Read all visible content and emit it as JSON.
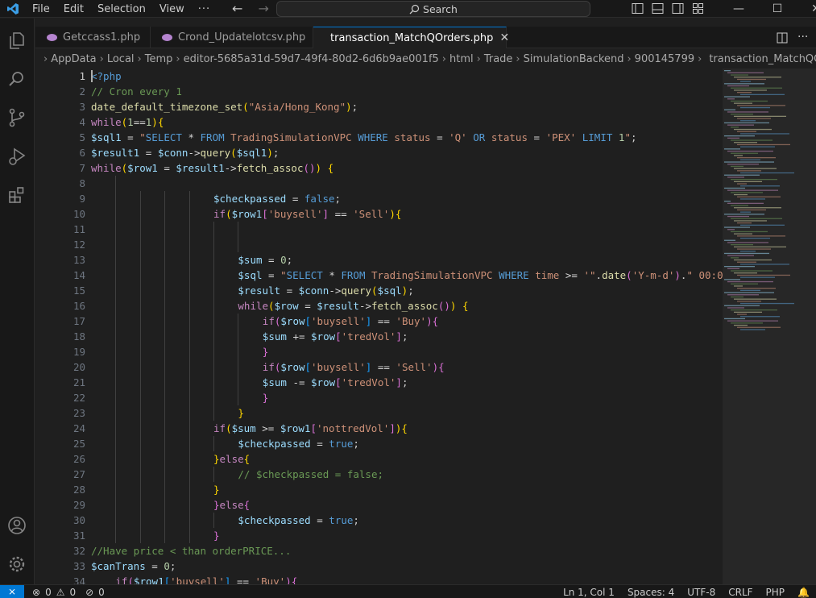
{
  "menu": {
    "file": "File",
    "edit": "Edit",
    "selection": "Selection",
    "view": "View",
    "more": "···"
  },
  "search": {
    "label": "Search"
  },
  "window": {
    "minimize": "—",
    "maximize": "☐",
    "close": "✕"
  },
  "tabs": [
    {
      "label": "Getccass1.php"
    },
    {
      "label": "Crond_Updatelotcsv.php"
    },
    {
      "label": "transaction_MatchQOrders.php",
      "close": "✕"
    }
  ],
  "breadcrumb": [
    "AppData",
    "Local",
    "Temp",
    "editor-5685a31d-59d7-49f4-80d2-6d6b9ae001f5",
    "html",
    "Trade",
    "SimulationBackend",
    "900145799",
    "transaction_MatchQOrders.php"
  ],
  "line_numbers": [
    "1",
    "2",
    "3",
    "4",
    "5",
    "6",
    "7",
    "8",
    "9",
    "10",
    "11",
    "12",
    "13",
    "14",
    "15",
    "16",
    "17",
    "18",
    "19",
    "20",
    "21",
    "22",
    "23",
    "24",
    "25",
    "26",
    "27",
    "28",
    "29",
    "30",
    "31",
    "32",
    "33",
    "34"
  ],
  "status": {
    "remote": "⨯",
    "errors": "0",
    "warnings": "0",
    "ports": "0",
    "position": "Ln 1, Col 1",
    "spaces": "Spaces: 4",
    "encoding": "UTF-8",
    "eol": "CRLF",
    "language": "PHP"
  },
  "colors": {
    "accent": "#0078d4",
    "background": "#1f1f1f",
    "chrome": "#181818"
  }
}
